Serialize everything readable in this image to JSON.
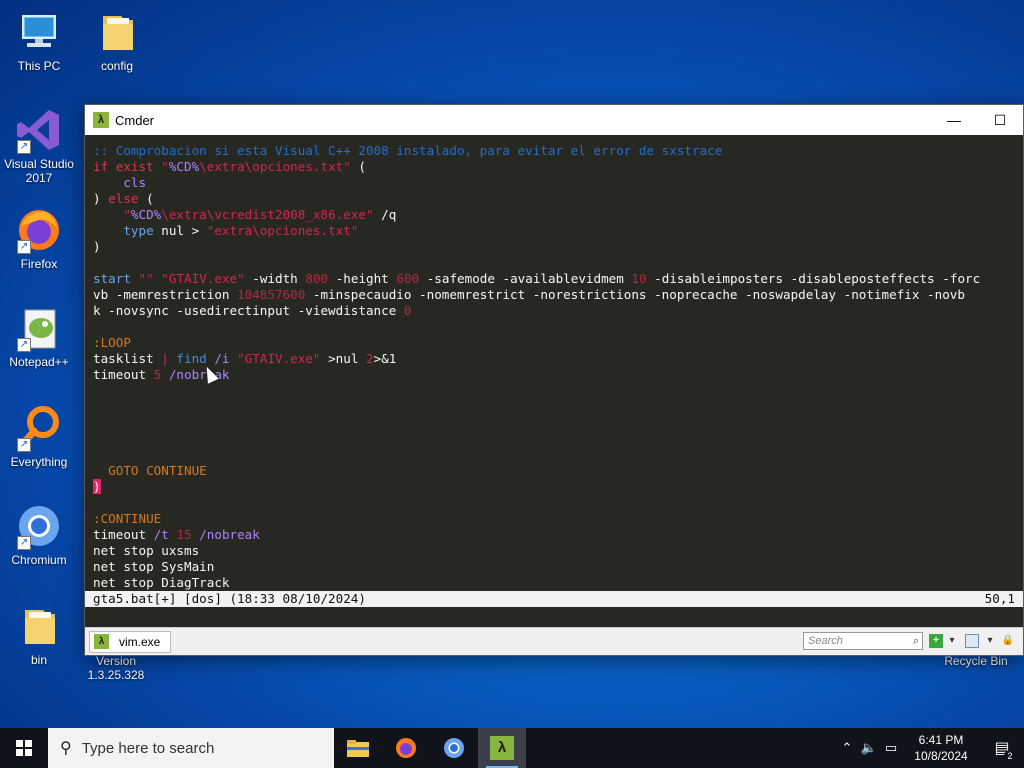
{
  "desktop": {
    "icons": [
      {
        "label": "This PC",
        "icon": "computer-icon"
      },
      {
        "label": "config",
        "icon": "folder-icon"
      },
      {
        "label": "Visual Studio 2017",
        "icon": "visual-studio-icon"
      },
      {
        "label": "Firefox",
        "icon": "firefox-icon"
      },
      {
        "label": "Notepad++",
        "icon": "notepad-plus-plus-icon"
      },
      {
        "label": "Everything",
        "icon": "everything-search-icon"
      },
      {
        "label": "Chromium",
        "icon": "chromium-icon"
      },
      {
        "label": "bin",
        "icon": "folder-icon"
      },
      {
        "label": "Recycle Bin",
        "icon": "recycle-bin-icon"
      }
    ],
    "partial_label": "Version 1.3.25.328"
  },
  "window": {
    "title": "Cmder",
    "minimize": "—",
    "maximize": "☐"
  },
  "terminal": {
    "lines": [
      [
        {
          "t": ":: Comprobacion si esta Visual C++ 2008 instalado, para evitar el error de sxstrace",
          "c": "c-comment"
        }
      ],
      [
        {
          "t": "if exist ",
          "c": "c-kw"
        },
        {
          "t": "\"",
          "c": "c-str"
        },
        {
          "t": "%CD%",
          "c": "c-var"
        },
        {
          "t": "\\extra\\opciones.txt\"",
          "c": "c-str"
        },
        {
          "t": " (",
          "c": ""
        }
      ],
      [
        {
          "t": "    cls",
          "c": "c-var"
        }
      ],
      [
        {
          "t": ") ",
          "c": ""
        },
        {
          "t": "else",
          "c": "c-kw"
        },
        {
          "t": " (",
          "c": ""
        }
      ],
      [
        {
          "t": "    \"",
          "c": "c-str"
        },
        {
          "t": "%CD%",
          "c": "c-var"
        },
        {
          "t": "\\extra\\vcredist2008_x86.exe\"",
          "c": "c-str"
        },
        {
          "t": " /q",
          "c": ""
        }
      ],
      [
        {
          "t": "    type",
          "c": "c-cyan"
        },
        {
          "t": " nul > ",
          "c": ""
        },
        {
          "t": "\"extra\\opciones.txt\"",
          "c": "c-str"
        }
      ],
      [
        {
          "t": ")",
          "c": ""
        }
      ],
      [
        {
          "t": "",
          "c": ""
        }
      ],
      [
        {
          "t": "start",
          "c": "c-cyan"
        },
        {
          "t": " ",
          "c": ""
        },
        {
          "t": "\"\"",
          "c": "c-str"
        },
        {
          "t": " ",
          "c": ""
        },
        {
          "t": "\"GTAIV.exe\"",
          "c": "c-str"
        },
        {
          "t": " -width ",
          "c": ""
        },
        {
          "t": "800",
          "c": "c-num"
        },
        {
          "t": " -height ",
          "c": ""
        },
        {
          "t": "600",
          "c": "c-num"
        },
        {
          "t": " -safemode -availablevidmem ",
          "c": ""
        },
        {
          "t": "10",
          "c": "c-num"
        },
        {
          "t": " -disableimposters -disableposteffects -forc",
          "c": ""
        }
      ],
      [
        {
          "t": "vb -memrestriction ",
          "c": ""
        },
        {
          "t": "104857600",
          "c": "c-num"
        },
        {
          "t": " -minspecaudio -nomemrestrict -norestrictions -noprecache -noswapdelay -notimefix -novb",
          "c": ""
        }
      ],
      [
        {
          "t": "k -novsync -usedirectinput -viewdistance ",
          "c": ""
        },
        {
          "t": "0",
          "c": "c-num"
        }
      ],
      [
        {
          "t": "",
          "c": ""
        }
      ],
      [
        {
          "t": ":LOOP",
          "c": "c-label"
        }
      ],
      [
        {
          "t": "tasklist ",
          "c": ""
        },
        {
          "t": "|",
          "c": "c-pipe"
        },
        {
          "t": " find ",
          "c": "c-find"
        },
        {
          "t": "/i",
          "c": "c-var"
        },
        {
          "t": " ",
          "c": ""
        },
        {
          "t": "\"GTAIV.exe\"",
          "c": "c-str"
        },
        {
          "t": " >nul ",
          "c": ""
        },
        {
          "t": "2",
          "c": "c-num"
        },
        {
          "t": ">&1",
          "c": ""
        }
      ],
      [
        {
          "t": "timeout ",
          "c": ""
        },
        {
          "t": "5",
          "c": "c-num"
        },
        {
          "t": " /nobreak",
          "c": "c-var"
        }
      ],
      [
        {
          "t": "",
          "c": ""
        }
      ],
      [
        {
          "t": "",
          "c": ""
        }
      ],
      [
        {
          "t": "",
          "c": ""
        }
      ],
      [
        {
          "t": "",
          "c": ""
        }
      ],
      [
        {
          "t": "",
          "c": ""
        }
      ],
      [
        {
          "t": "  GOTO CONTINUE",
          "c": "c-label"
        }
      ],
      [
        {
          "t": ")",
          "c": "cursorblock"
        }
      ],
      [
        {
          "t": "",
          "c": ""
        }
      ],
      [
        {
          "t": ":CONTINUE",
          "c": "c-label"
        }
      ],
      [
        {
          "t": "timeout ",
          "c": ""
        },
        {
          "t": "/t",
          "c": "c-var"
        },
        {
          "t": " ",
          "c": ""
        },
        {
          "t": "15",
          "c": "c-num"
        },
        {
          "t": " /nobreak",
          "c": "c-var"
        }
      ],
      [
        {
          "t": "net stop uxsms",
          "c": ""
        }
      ],
      [
        {
          "t": "net stop SysMain",
          "c": ""
        }
      ],
      [
        {
          "t": "net stop DiagTrack",
          "c": ""
        }
      ]
    ],
    "status_left": "gta5.bat[+] [dos] (18:33 08/10/2024)",
    "status_right": "50,1"
  },
  "cmder_tabs": {
    "tab_label": "vim.exe",
    "search_placeholder": "Search"
  },
  "taskbar": {
    "search_placeholder": "Type here to search",
    "time": "6:41 PM",
    "date": "10/8/2024",
    "notification_count": "2"
  },
  "colors": {
    "terminal_bg": "#272822",
    "accent": "#8ab53d"
  }
}
